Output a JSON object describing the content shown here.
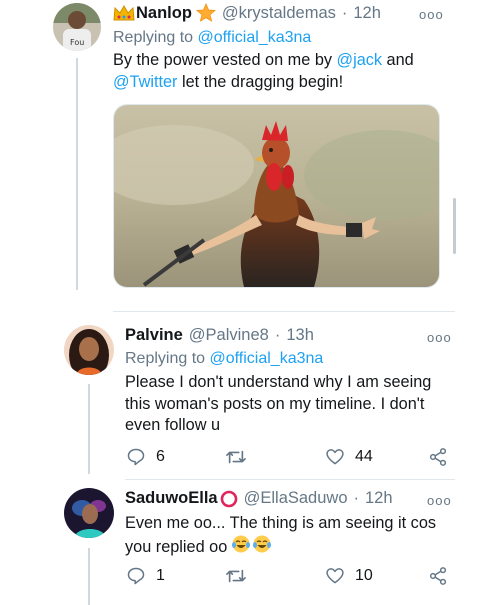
{
  "tweets": [
    {
      "name": "Nanlop",
      "name_prefix_emoji": "crown-emoji",
      "name_suffix_emoji": "star-emoji",
      "handle": "@krystaldemas",
      "time": "12h",
      "replying_label": "Replying to",
      "replying_to": "@official_ka3na",
      "text_parts": [
        "By the power vested on me by ",
        "@jack",
        " and",
        "@Twitter",
        " let the dragging begin!"
      ],
      "media": "rooster-image"
    },
    {
      "name": "Palvine",
      "handle": "@Palvine8",
      "time": "13h",
      "replying_label": "Replying to",
      "replying_to": "@official_ka3na",
      "text_lines": [
        "Please I don't understand why I am seeing",
        "this woman's posts on my timeline. I don't",
        "even follow u"
      ],
      "replies": "6",
      "retweets": "",
      "likes": "44"
    },
    {
      "name": "SaduwoElla",
      "name_suffix_emoji": "red-circle-emoji",
      "handle": "@EllaSaduwo",
      "time": "12h",
      "text_lines": [
        "Even me oo... The thing is am seeing it cos",
        "you replied oo"
      ],
      "text_emojis": [
        "tears-of-joy-emoji",
        "tears-of-joy-emoji"
      ],
      "replies": "1",
      "retweets": "",
      "likes": "10"
    }
  ],
  "sep": "·",
  "more_glyph": "ooo",
  "colors": {
    "link": "#1da1f2",
    "muted": "#657786",
    "text": "#14171a"
  }
}
